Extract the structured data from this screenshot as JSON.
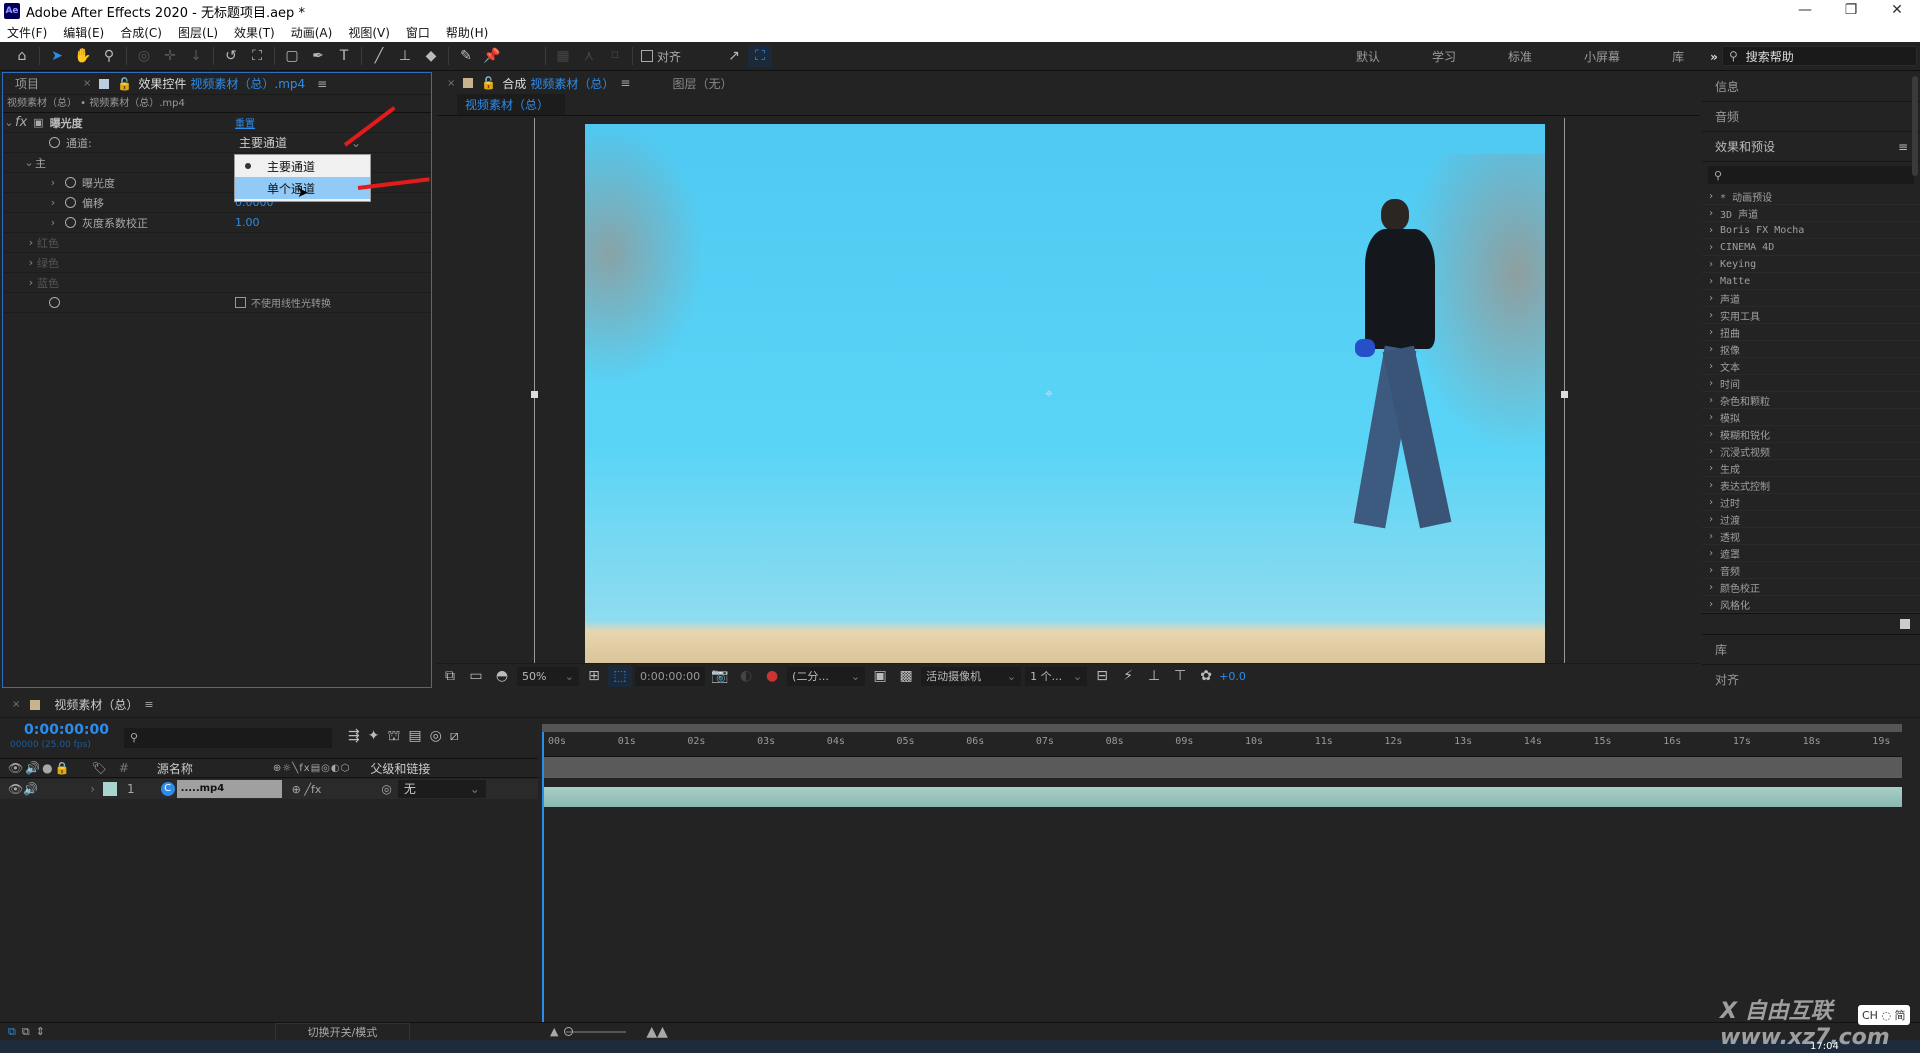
{
  "window": {
    "app_logo": "Ae",
    "title": "Adobe After Effects 2020 - 无标题项目.aep *",
    "controls": {
      "minimize": "—",
      "restore": "❐",
      "close": "✕"
    }
  },
  "menu": [
    "文件(F)",
    "编辑(E)",
    "合成(C)",
    "图层(L)",
    "效果(T)",
    "动画(A)",
    "视图(V)",
    "窗口",
    "帮助(H)"
  ],
  "toolbar": {
    "snap_label": "对齐",
    "workspaces": [
      "默认",
      "学习",
      "标准",
      "小屏幕",
      "库"
    ],
    "more": "»",
    "help_search_placeholder": "搜索帮助"
  },
  "effect_controls": {
    "project_tab": "项目",
    "tab_prefix": "效果控件",
    "tab_file": "视频素材（总）.mp4",
    "breadcrumb": "视频素材（总） • 视频素材（总）.mp4",
    "effect_name": "曝光度",
    "reset": "重置",
    "channel_label": "通道:",
    "channel_value": "主要通道",
    "dropdown_options": [
      {
        "label": "主要通道",
        "selected": true
      },
      {
        "label": "单个通道",
        "hovered": true
      }
    ],
    "master_group": "主",
    "properties": [
      {
        "name": "曝光度",
        "value": ""
      },
      {
        "name": "偏移",
        "value": "0.0000"
      },
      {
        "name": "灰度系数校正",
        "value": "1.00"
      }
    ],
    "channels": [
      "红色",
      "绿色",
      "蓝色"
    ],
    "linear_checkbox_label": "不使用线性光转换",
    "linear_checked": false
  },
  "composition": {
    "tab_prefix": "合成",
    "tab_name": "视频素材（总）",
    "layer_tab": "图层（无）",
    "sub_tab": "视频素材（总）",
    "zoom": "50%",
    "timecode": "0:00:00:00",
    "resolution": "(二分...",
    "camera": "活动摄像机",
    "views": "1 个...",
    "exposure": "+0.0"
  },
  "right_panel": {
    "info": "信息",
    "audio": "音频",
    "effects_presets": "效果和预设",
    "search_placeholder": "",
    "effect_categories": [
      "* 动画预设",
      "3D 声道",
      "Boris FX Mocha",
      "CINEMA 4D",
      "Keying",
      "Matte",
      "声道",
      "实用工具",
      "扭曲",
      "抠像",
      "文本",
      "时间",
      "杂色和颗粒",
      "模拟",
      "模糊和锐化",
      "沉浸式视频",
      "生成",
      "表达式控制",
      "过时",
      "过渡",
      "透视",
      "遮罩",
      "音频",
      "颜色校正",
      "风格化"
    ],
    "library": "库",
    "align": "对齐"
  },
  "timeline": {
    "comp_name": "视频素材（总）",
    "timecode": "0:00:00:00",
    "frame_info": "00000 (25.00 fps)",
    "search_placeholder": "",
    "columns": {
      "num": "#",
      "source": "源名称",
      "parent": "父级和链接"
    },
    "layers": [
      {
        "index": "1",
        "name": ".....mp4",
        "parent": "无"
      }
    ],
    "ruler_ticks": [
      "00s",
      "01s",
      "02s",
      "03s",
      "04s",
      "05s",
      "06s",
      "07s",
      "08s",
      "09s",
      "10s",
      "11s",
      "12s",
      "13s",
      "14s",
      "15s",
      "16s",
      "17s",
      "18s",
      "19s"
    ],
    "toggle_label": "切换开关/模式"
  },
  "taskbar": {
    "time": "17:04",
    "ime": "CH ◌ 简"
  },
  "watermark": "X 自由互联 www.xz7.com"
}
